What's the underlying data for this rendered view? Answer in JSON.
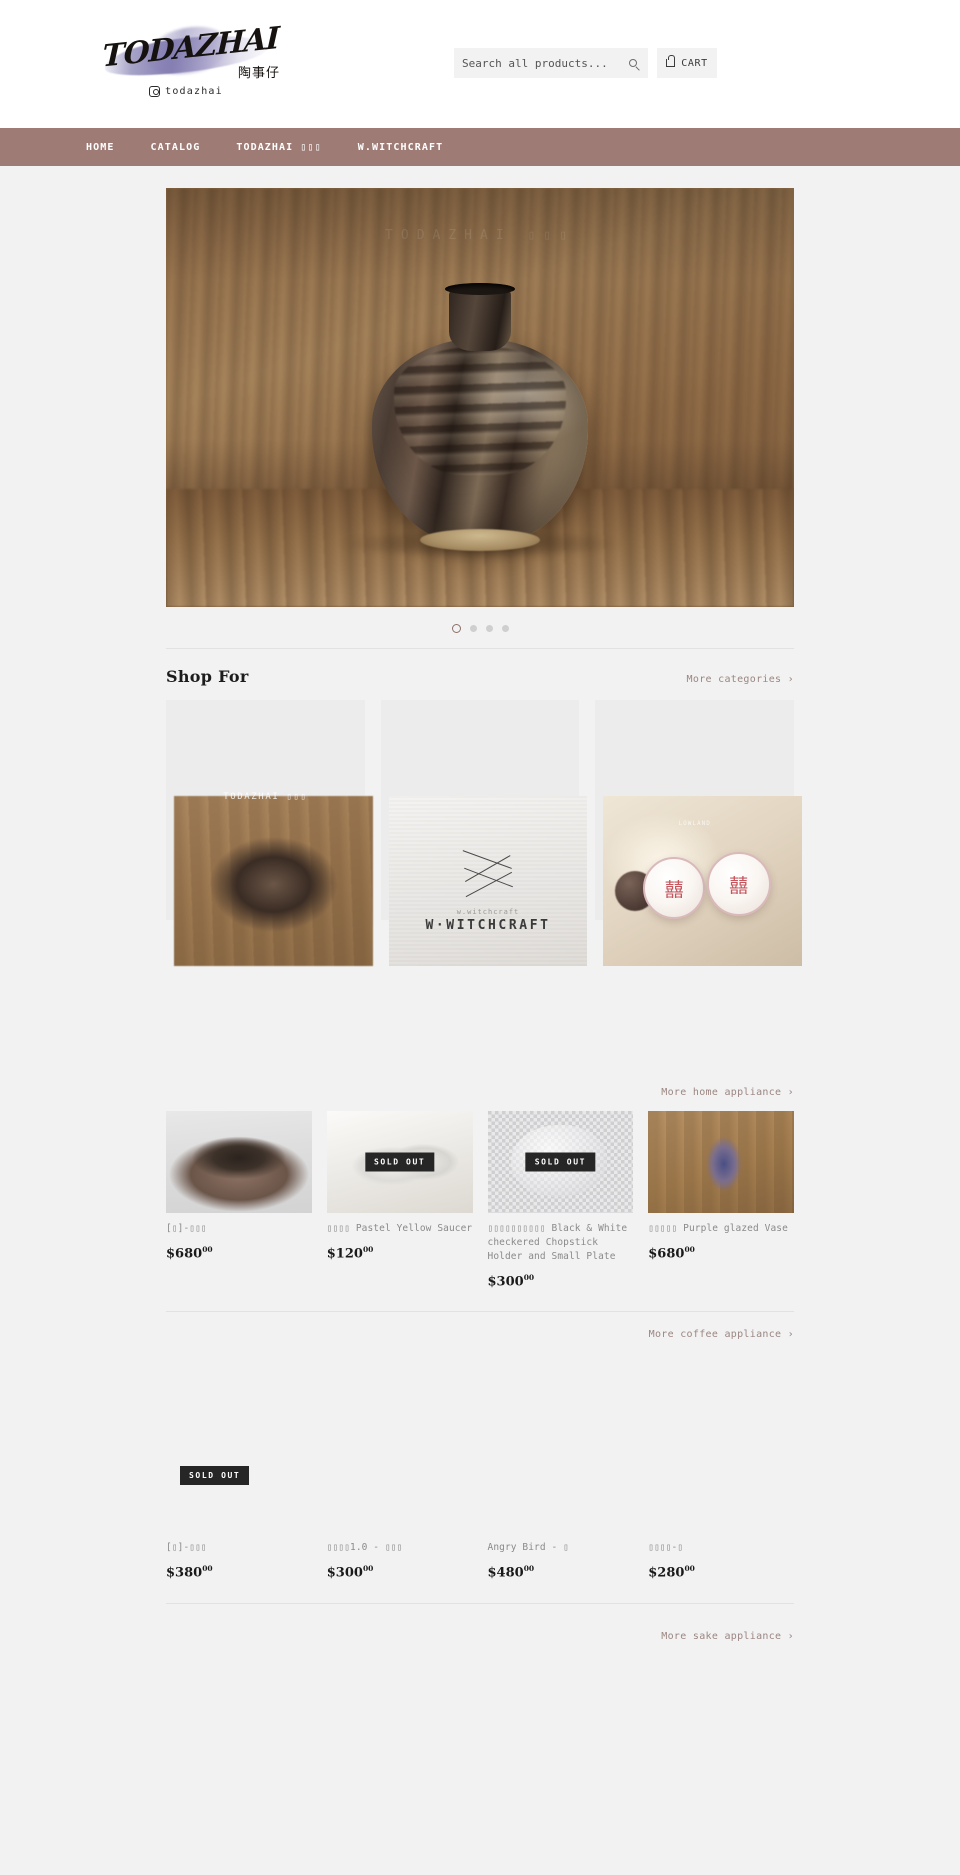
{
  "header": {
    "logo": {
      "wordmark": "TODAZHAI",
      "cjk": "陶事仔",
      "handle": "todazhai",
      "instagram_icon": "instagram-icon"
    },
    "search": {
      "placeholder": "Search all products...",
      "value": "",
      "submit_icon": "search-icon"
    },
    "cart": {
      "label": "CART",
      "icon": "cart-icon"
    }
  },
  "nav": {
    "items": [
      {
        "label": "HOME"
      },
      {
        "label": "CATALOG"
      },
      {
        "label": "TODAZHAI ▯▯▯"
      },
      {
        "label": "W.WITCHCRAFT"
      }
    ]
  },
  "hero": {
    "watermark": "TODAZHAI  ▯▯▯",
    "slides": 4,
    "active_slide": 1
  },
  "shop_for": {
    "title": "Shop For",
    "more_label": "More categories  ›",
    "categories": [
      {
        "label": "TODAZHAI  ▯▯▯",
        "image": "ceramic-vase-photo"
      },
      {
        "label": "",
        "image": "w-witchcraft-logo-photo",
        "caption_small": "w.witchcraft",
        "caption_large": "W·WITCHCRAFT"
      },
      {
        "label": "LOWLAND",
        "image": "pink-ceramic-coins-photo"
      }
    ]
  },
  "home_appliance": {
    "more_label": "More home appliance  ›",
    "products": [
      {
        "title": "[▯]-▯▯▯",
        "price": "$680",
        "cents": "00",
        "sold_out": false,
        "image": "dark-ceramic-bowl"
      },
      {
        "title": "▯▯▯▯ Pastel Yellow Saucer",
        "price": "$120",
        "cents": "00",
        "sold_out": true,
        "sold_label": "SOLD OUT",
        "image": "pastel-yellow-saucer"
      },
      {
        "title": "▯▯▯▯▯▯▯▯▯▯ Black & White checkered Chopstick Holder and Small Plate",
        "price": "$300",
        "cents": "00",
        "sold_out": true,
        "sold_label": "SOLD OUT",
        "image": "checkered-chopstick-holder"
      },
      {
        "title": "▯▯▯▯▯ Purple glazed Vase",
        "price": "$680",
        "cents": "00",
        "sold_out": false,
        "image": "purple-glazed-vase"
      }
    ]
  },
  "coffee_appliance": {
    "more_label": "More coffee appliance  ›",
    "products": [
      {
        "title": "[▯]-▯▯▯",
        "price": "$380",
        "cents": "00",
        "sold_out": true,
        "sold_label": "SOLD OUT",
        "image": "coffee-product-1"
      },
      {
        "title": "▯▯▯▯1.0 - ▯▯▯",
        "price": "$300",
        "cents": "00",
        "sold_out": false,
        "image": "coffee-product-2"
      },
      {
        "title": "Angry Bird - ▯",
        "price": "$480",
        "cents": "00",
        "sold_out": false,
        "image": "coffee-product-3"
      },
      {
        "title": "▯▯▯▯-▯",
        "price": "$280",
        "cents": "00",
        "sold_out": false,
        "image": "coffee-product-4"
      }
    ]
  },
  "sake_appliance": {
    "more_label": "More sake appliance  ›"
  },
  "colors": {
    "nav_bar": "#9e7b75",
    "page_bg": "#f2f2f2",
    "link": "#9b8682",
    "sold_badge": "#262626"
  }
}
